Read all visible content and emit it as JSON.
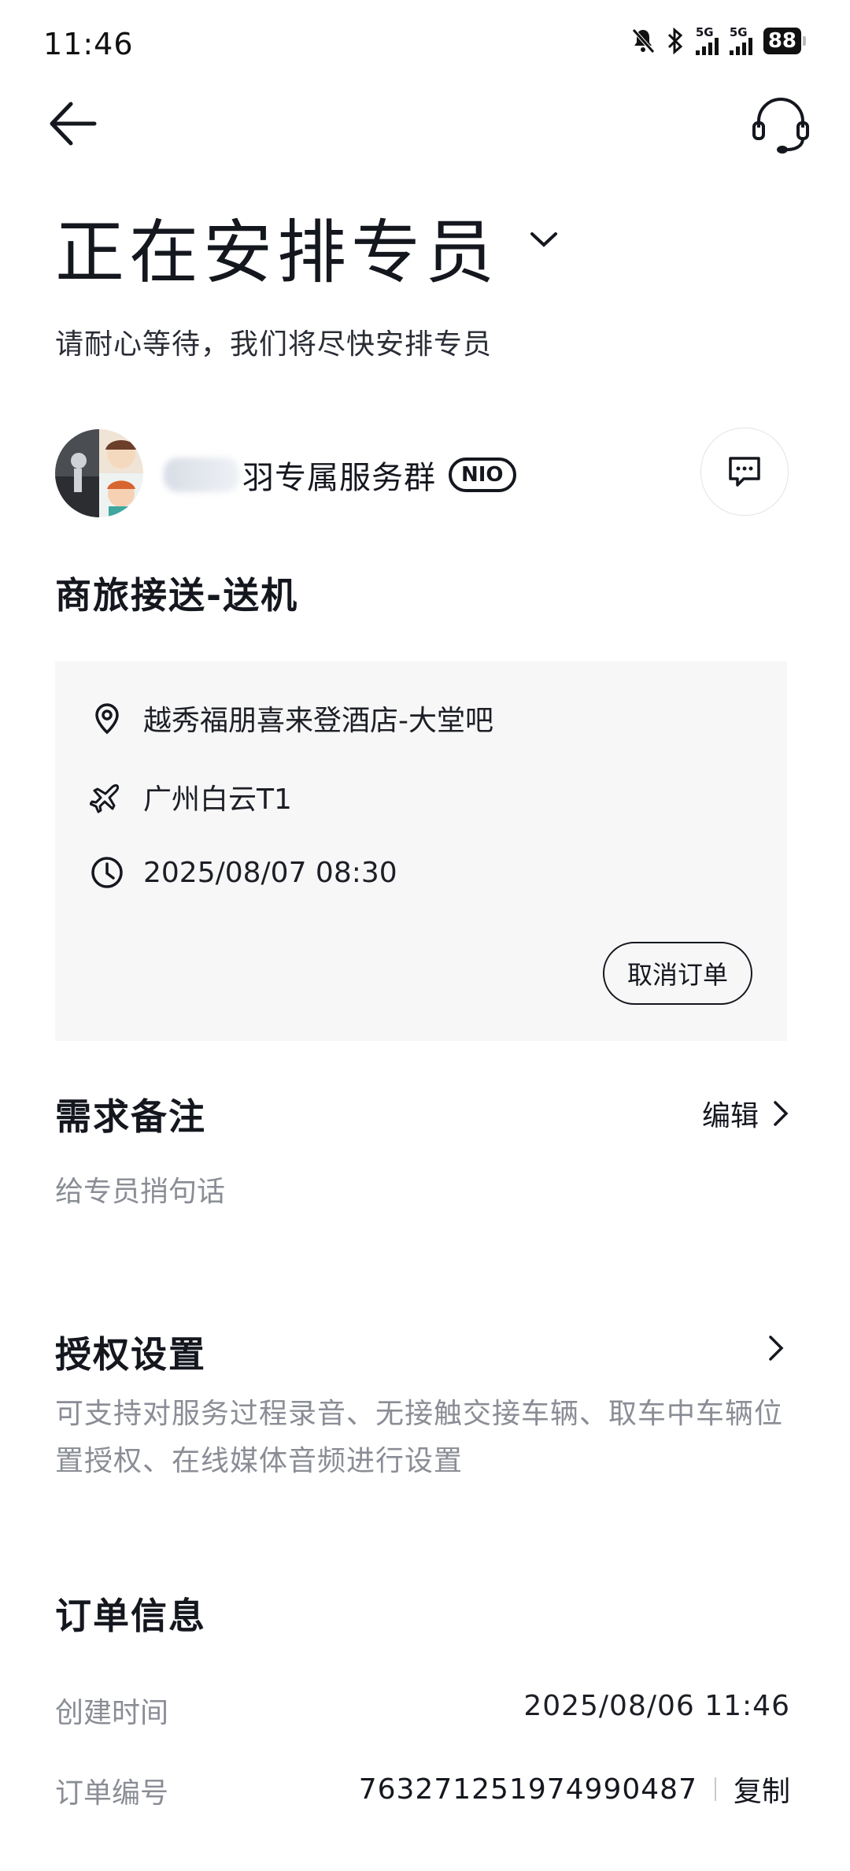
{
  "status_bar": {
    "time": "11:46",
    "network1": "5G",
    "network2": "5G",
    "battery": "88"
  },
  "header": {
    "title": "正在安排专员",
    "subtitle": "请耐心等待，我们将尽快安排专员"
  },
  "service_group": {
    "name": "羽专属服务群",
    "badge": "NIO"
  },
  "service_type": "商旅接送-送机",
  "trip": {
    "pickup": "越秀福朋喜来登酒店-大堂吧",
    "destination": "广州白云T1",
    "time": "2025/08/07 08:30",
    "cancel_label": "取消订单"
  },
  "notes": {
    "title": "需求备注",
    "edit_label": "编辑",
    "placeholder": "给专员捎句话"
  },
  "authorization": {
    "title": "授权设置",
    "description": "可支持对服务过程录音、无接触交接车辆、取车中车辆位置授权、在线媒体音频进行设置"
  },
  "order_info": {
    "title": "订单信息",
    "created_label": "创建时间",
    "created_value": "2025/08/06 11:46",
    "number_label": "订单编号",
    "number_value": "763271251974990487",
    "copy_label": "复制"
  }
}
